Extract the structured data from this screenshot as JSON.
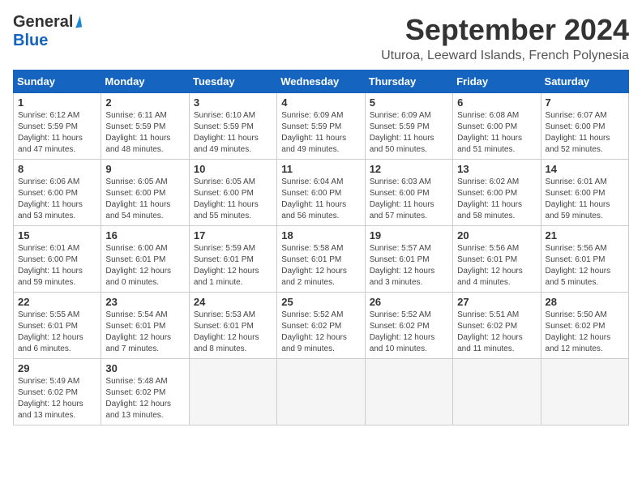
{
  "header": {
    "logo_general": "General",
    "logo_blue": "Blue",
    "month": "September 2024",
    "location": "Uturoa, Leeward Islands, French Polynesia"
  },
  "calendar": {
    "days_of_week": [
      "Sunday",
      "Monday",
      "Tuesday",
      "Wednesday",
      "Thursday",
      "Friday",
      "Saturday"
    ],
    "weeks": [
      [
        {
          "day": "1",
          "info": "Sunrise: 6:12 AM\nSunset: 5:59 PM\nDaylight: 11 hours\nand 47 minutes."
        },
        {
          "day": "2",
          "info": "Sunrise: 6:11 AM\nSunset: 5:59 PM\nDaylight: 11 hours\nand 48 minutes."
        },
        {
          "day": "3",
          "info": "Sunrise: 6:10 AM\nSunset: 5:59 PM\nDaylight: 11 hours\nand 49 minutes."
        },
        {
          "day": "4",
          "info": "Sunrise: 6:09 AM\nSunset: 5:59 PM\nDaylight: 11 hours\nand 49 minutes."
        },
        {
          "day": "5",
          "info": "Sunrise: 6:09 AM\nSunset: 5:59 PM\nDaylight: 11 hours\nand 50 minutes."
        },
        {
          "day": "6",
          "info": "Sunrise: 6:08 AM\nSunset: 6:00 PM\nDaylight: 11 hours\nand 51 minutes."
        },
        {
          "day": "7",
          "info": "Sunrise: 6:07 AM\nSunset: 6:00 PM\nDaylight: 11 hours\nand 52 minutes."
        }
      ],
      [
        {
          "day": "8",
          "info": "Sunrise: 6:06 AM\nSunset: 6:00 PM\nDaylight: 11 hours\nand 53 minutes."
        },
        {
          "day": "9",
          "info": "Sunrise: 6:05 AM\nSunset: 6:00 PM\nDaylight: 11 hours\nand 54 minutes."
        },
        {
          "day": "10",
          "info": "Sunrise: 6:05 AM\nSunset: 6:00 PM\nDaylight: 11 hours\nand 55 minutes."
        },
        {
          "day": "11",
          "info": "Sunrise: 6:04 AM\nSunset: 6:00 PM\nDaylight: 11 hours\nand 56 minutes."
        },
        {
          "day": "12",
          "info": "Sunrise: 6:03 AM\nSunset: 6:00 PM\nDaylight: 11 hours\nand 57 minutes."
        },
        {
          "day": "13",
          "info": "Sunrise: 6:02 AM\nSunset: 6:00 PM\nDaylight: 11 hours\nand 58 minutes."
        },
        {
          "day": "14",
          "info": "Sunrise: 6:01 AM\nSunset: 6:00 PM\nDaylight: 11 hours\nand 59 minutes."
        }
      ],
      [
        {
          "day": "15",
          "info": "Sunrise: 6:01 AM\nSunset: 6:00 PM\nDaylight: 11 hours\nand 59 minutes."
        },
        {
          "day": "16",
          "info": "Sunrise: 6:00 AM\nSunset: 6:01 PM\nDaylight: 12 hours\nand 0 minutes."
        },
        {
          "day": "17",
          "info": "Sunrise: 5:59 AM\nSunset: 6:01 PM\nDaylight: 12 hours\nand 1 minute."
        },
        {
          "day": "18",
          "info": "Sunrise: 5:58 AM\nSunset: 6:01 PM\nDaylight: 12 hours\nand 2 minutes."
        },
        {
          "day": "19",
          "info": "Sunrise: 5:57 AM\nSunset: 6:01 PM\nDaylight: 12 hours\nand 3 minutes."
        },
        {
          "day": "20",
          "info": "Sunrise: 5:56 AM\nSunset: 6:01 PM\nDaylight: 12 hours\nand 4 minutes."
        },
        {
          "day": "21",
          "info": "Sunrise: 5:56 AM\nSunset: 6:01 PM\nDaylight: 12 hours\nand 5 minutes."
        }
      ],
      [
        {
          "day": "22",
          "info": "Sunrise: 5:55 AM\nSunset: 6:01 PM\nDaylight: 12 hours\nand 6 minutes."
        },
        {
          "day": "23",
          "info": "Sunrise: 5:54 AM\nSunset: 6:01 PM\nDaylight: 12 hours\nand 7 minutes."
        },
        {
          "day": "24",
          "info": "Sunrise: 5:53 AM\nSunset: 6:01 PM\nDaylight: 12 hours\nand 8 minutes."
        },
        {
          "day": "25",
          "info": "Sunrise: 5:52 AM\nSunset: 6:02 PM\nDaylight: 12 hours\nand 9 minutes."
        },
        {
          "day": "26",
          "info": "Sunrise: 5:52 AM\nSunset: 6:02 PM\nDaylight: 12 hours\nand 10 minutes."
        },
        {
          "day": "27",
          "info": "Sunrise: 5:51 AM\nSunset: 6:02 PM\nDaylight: 12 hours\nand 11 minutes."
        },
        {
          "day": "28",
          "info": "Sunrise: 5:50 AM\nSunset: 6:02 PM\nDaylight: 12 hours\nand 12 minutes."
        }
      ],
      [
        {
          "day": "29",
          "info": "Sunrise: 5:49 AM\nSunset: 6:02 PM\nDaylight: 12 hours\nand 13 minutes."
        },
        {
          "day": "30",
          "info": "Sunrise: 5:48 AM\nSunset: 6:02 PM\nDaylight: 12 hours\nand 13 minutes."
        },
        {
          "day": "",
          "info": ""
        },
        {
          "day": "",
          "info": ""
        },
        {
          "day": "",
          "info": ""
        },
        {
          "day": "",
          "info": ""
        },
        {
          "day": "",
          "info": ""
        }
      ]
    ]
  }
}
